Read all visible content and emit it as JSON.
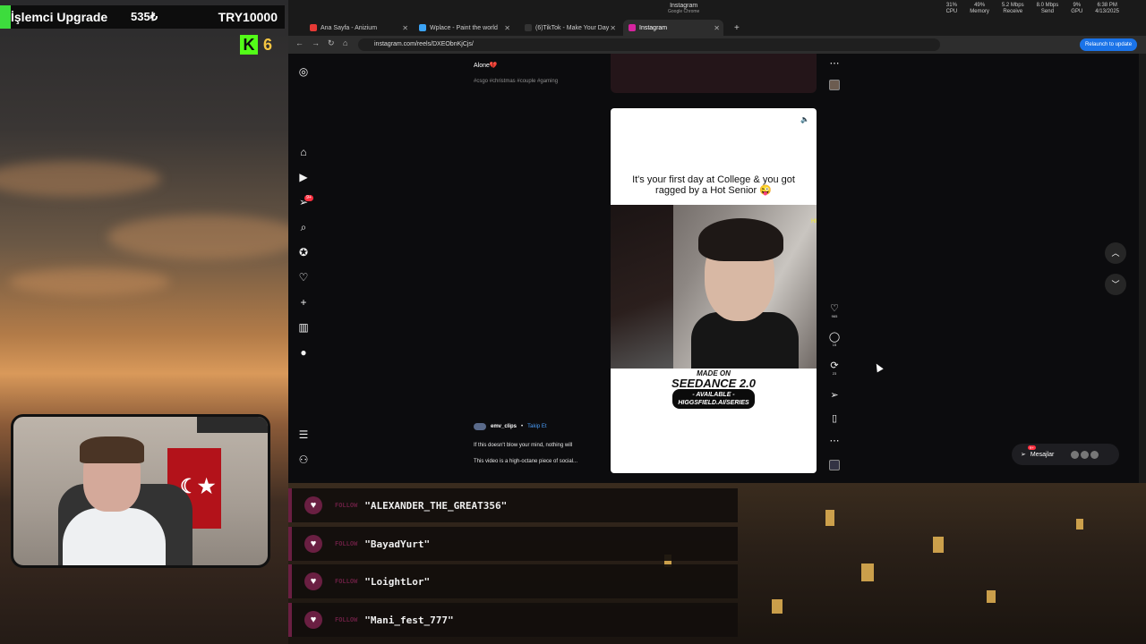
{
  "overlay": {
    "upgrade_title": "İşlemci Upgrade",
    "upgrade_price": "535₺",
    "upgrade_target": "TRY10000",
    "kick_logo": "K",
    "kick_count": "6"
  },
  "os": {
    "title_app": "Instagram",
    "title_sub": "Google Chrome",
    "stats": [
      {
        "value": "31%",
        "label": "CPU"
      },
      {
        "value": "49%",
        "label": "Memory"
      },
      {
        "value": "5.2 Mbps",
        "label": "Receive"
      },
      {
        "value": "8.0 Mbps",
        "label": "Send"
      },
      {
        "value": "9%",
        "label": "GPU"
      },
      {
        "value": "6:38 PM",
        "label": "4/13/2025"
      }
    ]
  },
  "browser": {
    "tabs": [
      {
        "label": "Ana Sayfa - Anizium",
        "color": "#e53935"
      },
      {
        "label": "Wplace - Paint the world",
        "color": "#3ba3f5"
      },
      {
        "label": "(6)TikTok - Make Your Day",
        "color": "#111111"
      },
      {
        "label": "Instagram",
        "color": "#d6249f"
      }
    ],
    "url": "instagram.com/reels/DXEObnKjCjs/",
    "relaunch_label": "Relaunch to update"
  },
  "instagram": {
    "nav_badge": "9+",
    "post_title": "Alone💔",
    "post_tags": "#csgo #christmas #couple #gaming",
    "reel": {
      "caption_line1": "It's your first day at College & you got",
      "caption_line2": "ragged by a Hot Senior 😜",
      "brand_made": "MADE ON",
      "brand_name": "SEEDANCE 2.0",
      "brand_avail_1": "- AVAILABLE -",
      "brand_avail_2": "HIGGSFIELD.AI/SERIES",
      "side_watermark": "HI"
    },
    "author": {
      "name": "emv_clips",
      "sep": "•",
      "follow": "Takip Et"
    },
    "desc_line1": "If this doesn't blow your mind, nothing will",
    "desc_line2": "This video is a high-octane piece of social...",
    "actions": {
      "likes": "965",
      "comments": "15",
      "reposts": "23"
    },
    "messages_label": "Mesajlar",
    "messages_badge": "9+"
  },
  "follows": {
    "tag": "FOLLOW",
    "names": [
      "\"ALEXANDER_THE_GREAT356\"",
      "\"BayadYurt\"",
      "\"LoightLor\"",
      "\"Mani_fest_777\""
    ]
  }
}
